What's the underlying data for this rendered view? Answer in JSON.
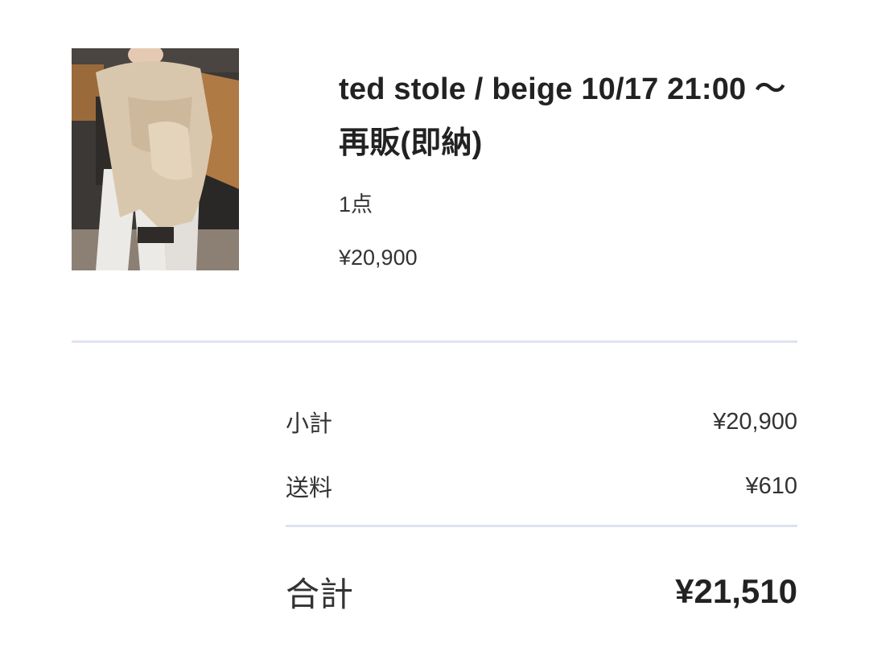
{
  "item": {
    "title": "ted stole / beige 10/17 21:00 〜 再販(即納)",
    "quantity": "1点",
    "price": "¥20,900"
  },
  "summary": {
    "subtotal_label": "小計",
    "subtotal_value": "¥20,900",
    "shipping_label": "送料",
    "shipping_value": "¥610",
    "total_label": "合計",
    "total_value": "¥21,510"
  },
  "colors": {
    "divider": "#dde3ee",
    "text": "#333333",
    "product_beige": "#d9c7ad"
  }
}
